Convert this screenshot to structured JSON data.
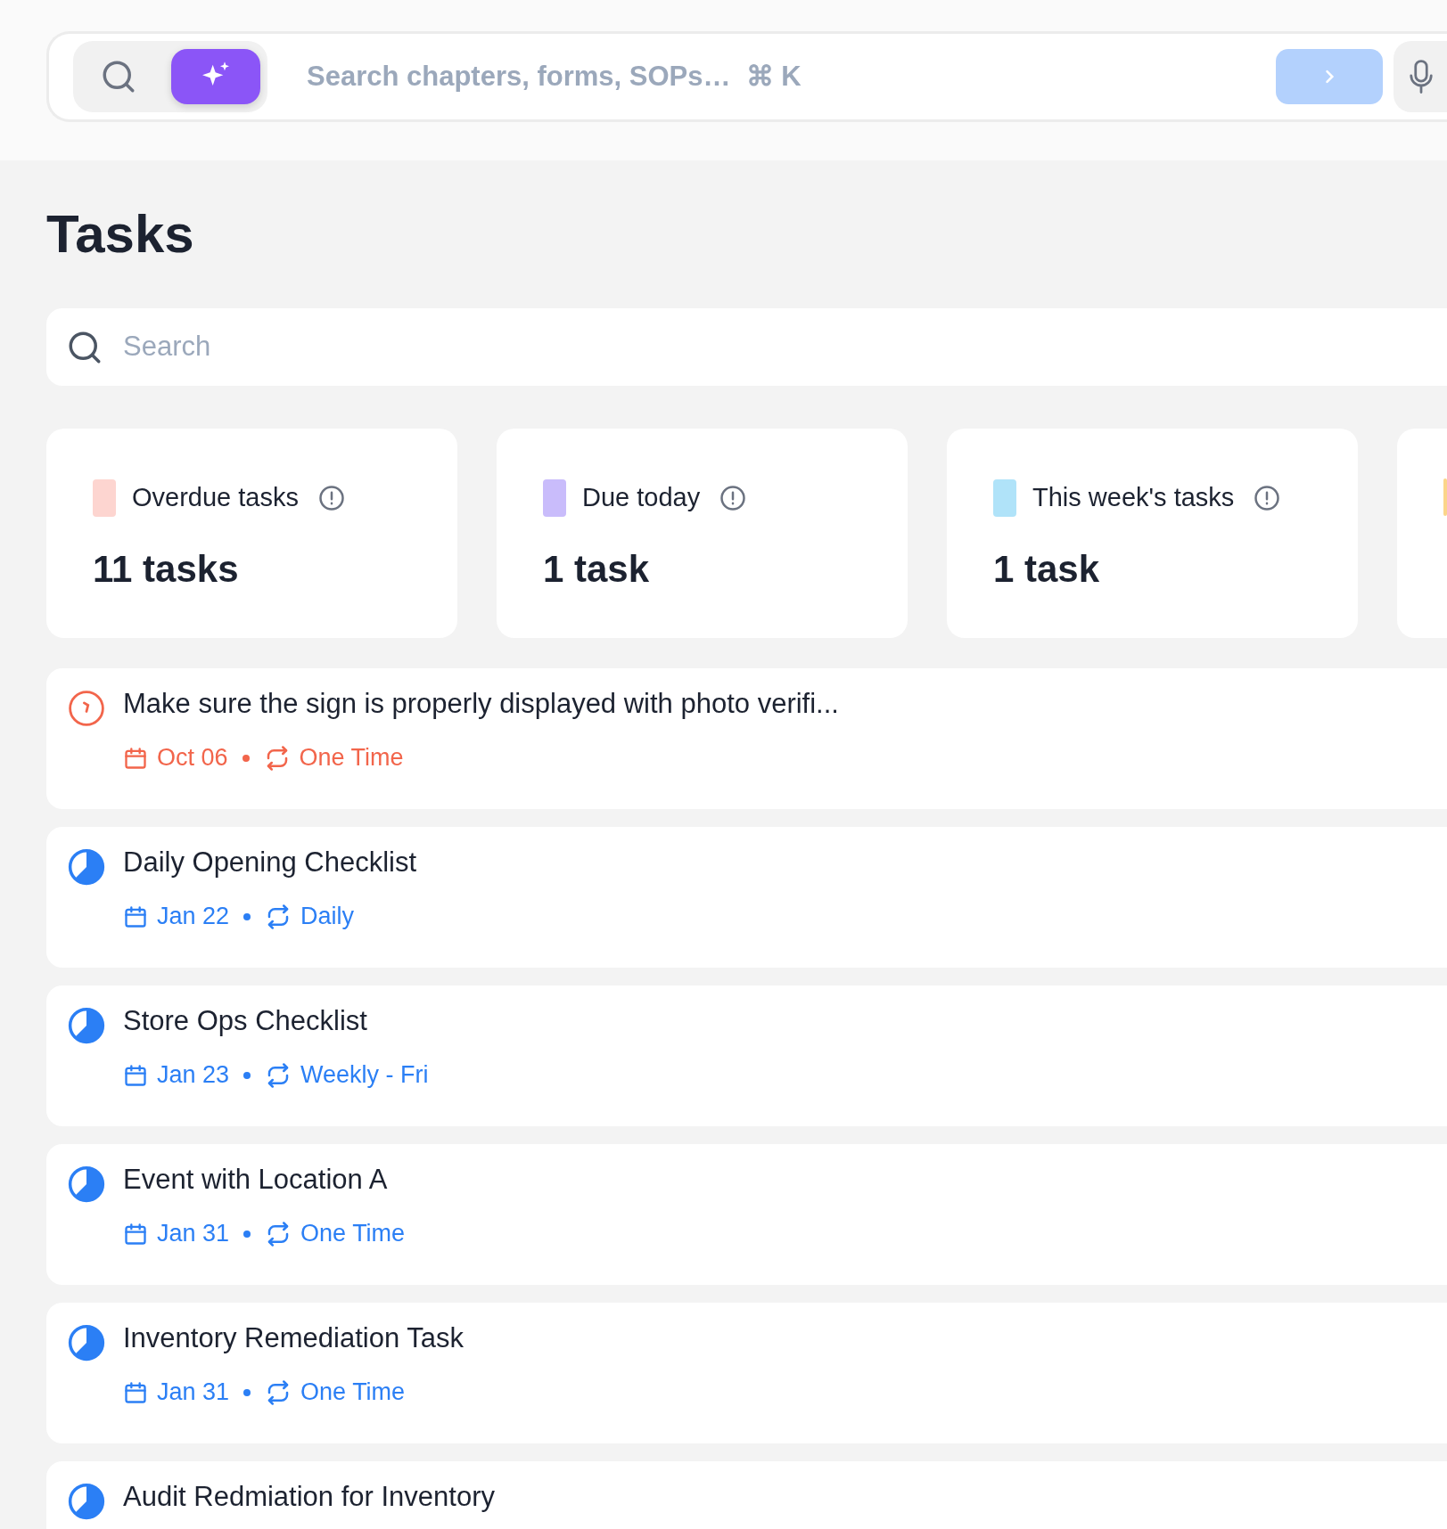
{
  "search_bar": {
    "placeholder": "Search chapters, forms, SOPs…  ⌘ K"
  },
  "page_title": "Tasks",
  "task_search": {
    "placeholder": "Search"
  },
  "summary_cards": [
    {
      "label": "Overdue tasks",
      "value": "11 tasks",
      "color": "#fdd5d0"
    },
    {
      "label": "Due today",
      "value": "1 task",
      "color": "#c9bcfb"
    },
    {
      "label": "This week's tasks",
      "value": "1 task",
      "color": "#b0e3f9"
    },
    {
      "color": "#fbd58a"
    }
  ],
  "tasks": [
    {
      "kind": "overdue",
      "title": "Make sure the sign is properly displayed with photo verifi...",
      "date": "Oct 06",
      "recurrence": "One Time"
    },
    {
      "kind": "in_progress",
      "title": "Daily Opening Checklist",
      "date": "Jan 22",
      "recurrence": "Daily"
    },
    {
      "kind": "in_progress",
      "title": "Store Ops Checklist",
      "date": "Jan 23",
      "recurrence": "Weekly - Fri"
    },
    {
      "kind": "in_progress",
      "title": "Event with Location A",
      "date": "Jan 31",
      "recurrence": "One Time"
    },
    {
      "kind": "in_progress",
      "title": "Inventory Remediation Task",
      "date": "Jan 31",
      "recurrence": "One Time"
    },
    {
      "kind": "in_progress",
      "title": "Audit Redmiation for Inventory"
    }
  ]
}
